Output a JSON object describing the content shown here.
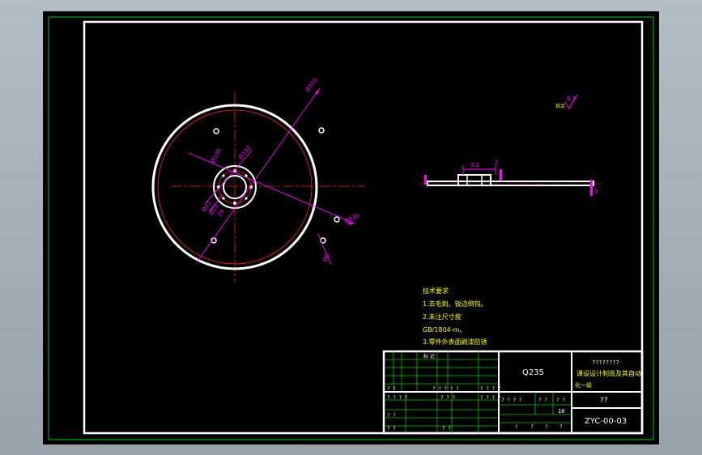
{
  "colors": {
    "background": "#000000",
    "frame": "#ffffff",
    "outer_border": "#00c800",
    "centerline": "#ff2020",
    "dimension": "#ff00ff",
    "note_text": "#ffff00",
    "grid": "#00c800",
    "title_text": "#ffffff"
  },
  "dimensions": {
    "d1": "Ø350",
    "d2": "Ø330",
    "d3": "Ø130",
    "d4": "Ø100",
    "d5": "Ø11",
    "d6": "Ø10",
    "d7": "28",
    "d8": "Ø8",
    "roughness": "6.3",
    "roughness_note": "其余",
    "side_top": "2",
    "side_right": "3",
    "side_width": "3.2"
  },
  "notes": {
    "heading": "技术要求",
    "line1": "1.去毛刺、锐边倒钝。",
    "line2": "2.未注尺寸按",
    "line3": "GB/1804-m。",
    "line4": "3.零件外表面刷漆防锈"
  },
  "title_block": {
    "material": "Q235",
    "name_line1": "????????",
    "name_line2": "课设设计制造及其自动",
    "name_line3": "化一级",
    "part_name": "??",
    "drawing_no": "ZYC-00-03",
    "left_header": "标 记",
    "left_r1": "? ?",
    "left_r2": "? ?  ? ?",
    "left_r2b": "? ? ? ? ?",
    "left_r2c": "? ? ? ?",
    "left_r3": "? ?  ? ?",
    "left_r3b": "? ? ?",
    "left_r3c": "? ? ? ?",
    "left_r4": "? ?",
    "left_r5": "? ?",
    "left_r5b": "? ?",
    "mid_r1a": "? ? ? ?",
    "mid_r1b": "? ?",
    "mid_r1c": "? ?",
    "mid_r2": "10",
    "mid_r3a": "?",
    "mid_r3b": "?",
    "mid_r3c": "?",
    "mid_r3d": "?"
  }
}
